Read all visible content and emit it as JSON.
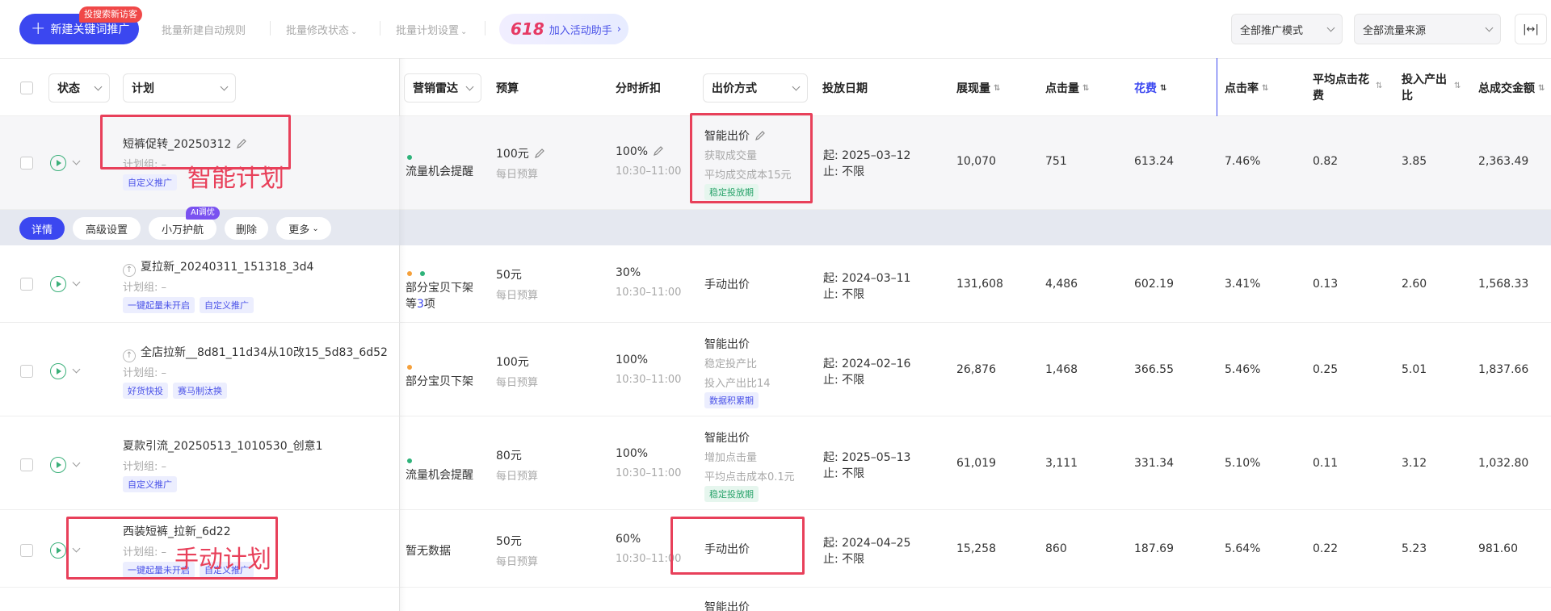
{
  "toolbar": {
    "new_button_label": "新建关键词推广",
    "new_button_badge": "投搜索新访客",
    "batch_rule": "批量新建自动规则",
    "batch_status": "批量修改状态",
    "batch_plan": "批量计划设置",
    "promo_618": "618",
    "promo_text": "加入活动助手",
    "mode_select": "全部推广模式",
    "source_select": "全部流量来源",
    "width_icon": "|↔|"
  },
  "header": {
    "status": "状态",
    "plan": "计划",
    "radar": "营销雷达",
    "budget": "预算",
    "discount": "分时折扣",
    "bid": "出价方式",
    "date": "投放日期",
    "impressions": "展现量",
    "clicks": "点击量",
    "cost": "花费",
    "ctr": "点击率",
    "avg_cpc_1": "平均点击花",
    "avg_cpc_2": "费",
    "roi_1": "投入产出",
    "roi_2": "比",
    "gmv": "总成交金额"
  },
  "actions": {
    "detail": "详情",
    "advanced": "高级设置",
    "assistant": "小万护航",
    "delete": "删除",
    "more": "更多",
    "ai_badge": "AI调优"
  },
  "rows": [
    {
      "name": "短裤促转_20250312",
      "group": "计划组: –",
      "tags": [
        "自定义推广"
      ],
      "radar": "流量机会提醒",
      "budget": "100元",
      "budget_sub": "每日预算",
      "discount": "100%",
      "discount_sub": "10:30–11:00",
      "bid": "智能出价",
      "bid_l2": "获取成交量",
      "bid_l3": "平均成交成本15元",
      "bid_tag": "稳定投放期",
      "start": "起: 2025–03–12",
      "end": "止: 不限",
      "impressions": "10,070",
      "clicks": "751",
      "cost": "613.24",
      "ctr": "7.46%",
      "cpc": "0.82",
      "roi": "3.85",
      "gmv": "2,363.49"
    },
    {
      "name": "夏拉新_20240311_151318_3d4",
      "group": "计划组: –",
      "tags": [
        "一键起量未开启",
        "自定义推广"
      ],
      "radar_l1": "部分宝贝下架",
      "radar_l2a": "等",
      "radar_l2b": "3",
      "radar_l2c": "项",
      "budget": "50元",
      "budget_sub": "每日预算",
      "discount": "30%",
      "discount_sub": "10:30–11:00",
      "bid": "手动出价",
      "start": "起: 2024–03–11",
      "end": "止: 不限",
      "impressions": "131,608",
      "clicks": "4,486",
      "cost": "602.19",
      "ctr": "3.41%",
      "cpc": "0.13",
      "roi": "2.60",
      "gmv": "1,568.33"
    },
    {
      "name": "全店拉新__8d81_11d34从10改15_5d83_6d52",
      "group": "计划组: –",
      "tags": [
        "好货快投",
        "赛马制汰换"
      ],
      "radar": "部分宝贝下架",
      "budget": "100元",
      "budget_sub": "每日预算",
      "discount": "100%",
      "discount_sub": "10:30–11:00",
      "bid": "智能出价",
      "bid_l2": "稳定投产比",
      "bid_l3": "投入产出比14",
      "bid_tag": "数据积累期",
      "start": "起: 2024–02–16",
      "end": "止: 不限",
      "impressions": "26,876",
      "clicks": "1,468",
      "cost": "366.55",
      "ctr": "5.46%",
      "cpc": "0.25",
      "roi": "5.01",
      "gmv": "1,837.66"
    },
    {
      "name": "夏款引流_20250513_1010530_创意1",
      "group": "计划组: –",
      "tags": [
        "自定义推广"
      ],
      "radar": "流量机会提醒",
      "budget": "80元",
      "budget_sub": "每日预算",
      "discount": "100%",
      "discount_sub": "10:30–11:00",
      "bid": "智能出价",
      "bid_l2": "增加点击量",
      "bid_l3": "平均点击成本0.1元",
      "bid_tag": "稳定投放期",
      "start": "起: 2025–05–13",
      "end": "止: 不限",
      "impressions": "61,019",
      "clicks": "3,111",
      "cost": "331.34",
      "ctr": "5.10%",
      "cpc": "0.11",
      "roi": "3.12",
      "gmv": "1,032.80"
    },
    {
      "name": "西装短裤_拉新_6d22",
      "group": "计划组: –",
      "tags": [
        "一键起量未开启",
        "自定义推广"
      ],
      "radar": "暂无数据",
      "budget": "50元",
      "budget_sub": "每日预算",
      "discount": "60%",
      "discount_sub": "10:30–11:00",
      "bid": "手动出价",
      "start": "起: 2024–04–25",
      "end": "止: 不限",
      "impressions": "15,258",
      "clicks": "860",
      "cost": "187.69",
      "ctr": "5.64%",
      "cpc": "0.22",
      "roi": "5.23",
      "gmv": "981.60"
    },
    {
      "bid": "智能出价"
    }
  ],
  "annotations": {
    "smart": "智能计划",
    "manual": "手动计划"
  },
  "colors": {
    "primary": "#3b47f0",
    "annotation": "#e8405a",
    "active_green": "#3bb07a"
  }
}
